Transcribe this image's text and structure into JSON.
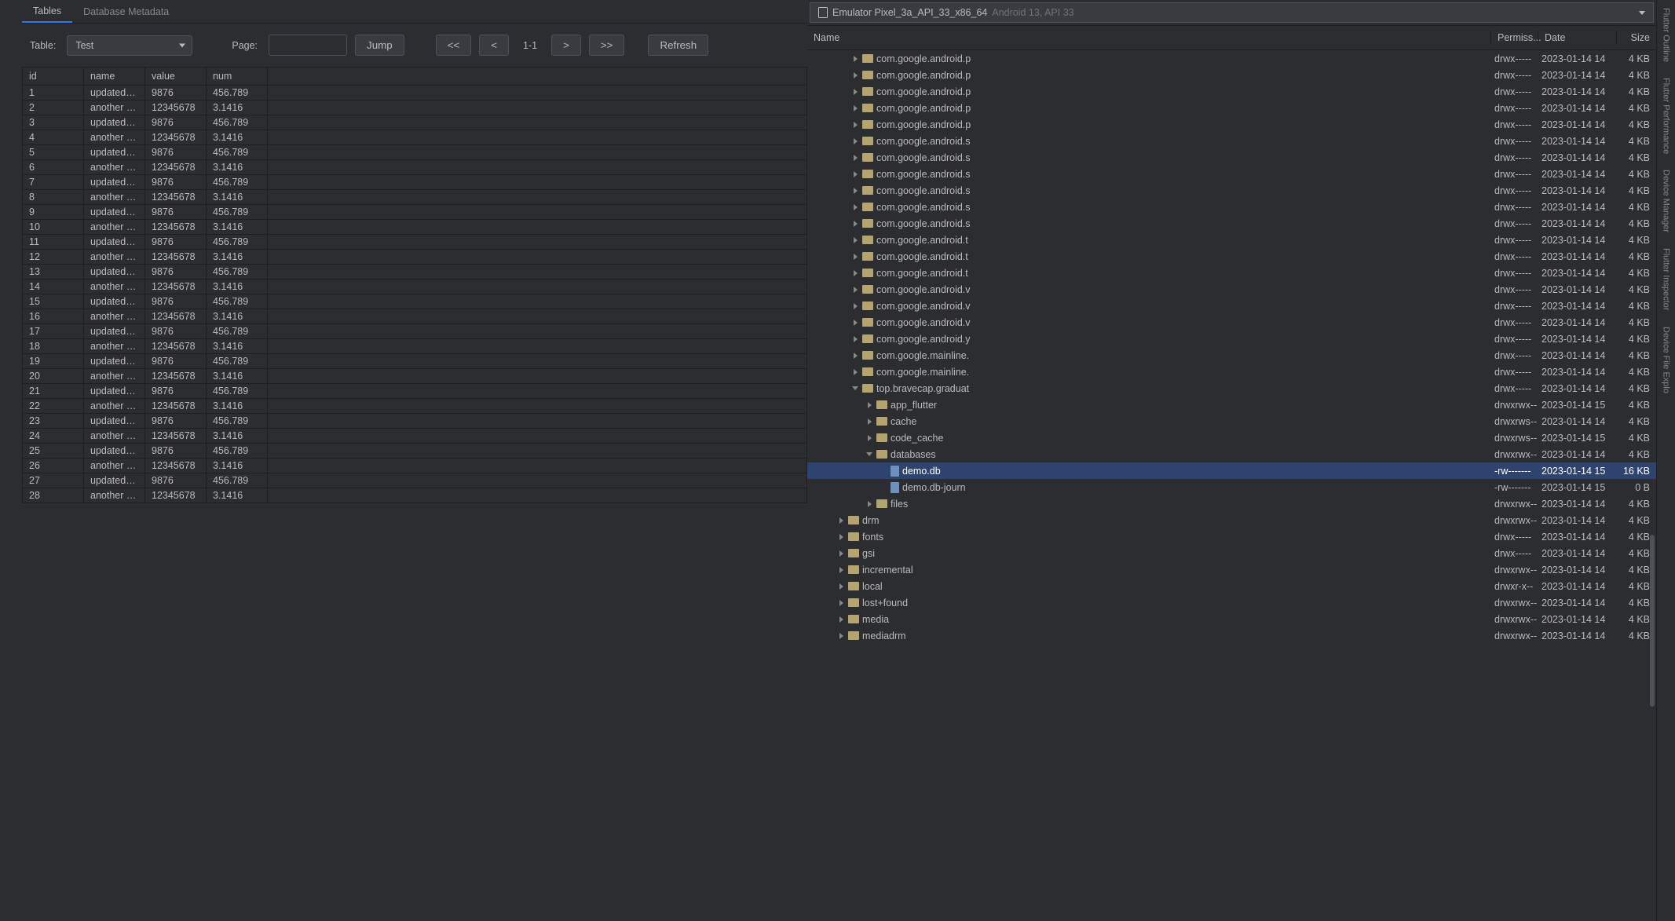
{
  "tabs": {
    "tables": "Tables",
    "metadata": "Database Metadata"
  },
  "toolbar": {
    "table_label": "Table:",
    "table_value": "Test",
    "page_label": "Page:",
    "page_value": "",
    "jump": "Jump",
    "first": "<<",
    "prev": "<",
    "counter": "1-1",
    "next": ">",
    "last": ">>",
    "refresh": "Refresh"
  },
  "table": {
    "headers": {
      "id": "id",
      "name": "name",
      "value": "value",
      "num": "num"
    },
    "rows": [
      {
        "id": "1",
        "name": "updated n...",
        "value": "9876",
        "num": "456.789"
      },
      {
        "id": "2",
        "name": "another n...",
        "value": "12345678",
        "num": "3.1416"
      },
      {
        "id": "3",
        "name": "updated n...",
        "value": "9876",
        "num": "456.789"
      },
      {
        "id": "4",
        "name": "another n...",
        "value": "12345678",
        "num": "3.1416"
      },
      {
        "id": "5",
        "name": "updated n...",
        "value": "9876",
        "num": "456.789"
      },
      {
        "id": "6",
        "name": "another n...",
        "value": "12345678",
        "num": "3.1416"
      },
      {
        "id": "7",
        "name": "updated n...",
        "value": "9876",
        "num": "456.789"
      },
      {
        "id": "8",
        "name": "another n...",
        "value": "12345678",
        "num": "3.1416"
      },
      {
        "id": "9",
        "name": "updated n...",
        "value": "9876",
        "num": "456.789"
      },
      {
        "id": "10",
        "name": "another n...",
        "value": "12345678",
        "num": "3.1416"
      },
      {
        "id": "11",
        "name": "updated n...",
        "value": "9876",
        "num": "456.789"
      },
      {
        "id": "12",
        "name": "another n...",
        "value": "12345678",
        "num": "3.1416"
      },
      {
        "id": "13",
        "name": "updated n...",
        "value": "9876",
        "num": "456.789"
      },
      {
        "id": "14",
        "name": "another n...",
        "value": "12345678",
        "num": "3.1416"
      },
      {
        "id": "15",
        "name": "updated n...",
        "value": "9876",
        "num": "456.789"
      },
      {
        "id": "16",
        "name": "another n...",
        "value": "12345678",
        "num": "3.1416"
      },
      {
        "id": "17",
        "name": "updated n...",
        "value": "9876",
        "num": "456.789"
      },
      {
        "id": "18",
        "name": "another n...",
        "value": "12345678",
        "num": "3.1416"
      },
      {
        "id": "19",
        "name": "updated n...",
        "value": "9876",
        "num": "456.789"
      },
      {
        "id": "20",
        "name": "another n...",
        "value": "12345678",
        "num": "3.1416"
      },
      {
        "id": "21",
        "name": "updated n...",
        "value": "9876",
        "num": "456.789"
      },
      {
        "id": "22",
        "name": "another n...",
        "value": "12345678",
        "num": "3.1416"
      },
      {
        "id": "23",
        "name": "updated n...",
        "value": "9876",
        "num": "456.789"
      },
      {
        "id": "24",
        "name": "another n...",
        "value": "12345678",
        "num": "3.1416"
      },
      {
        "id": "25",
        "name": "updated n...",
        "value": "9876",
        "num": "456.789"
      },
      {
        "id": "26",
        "name": "another n...",
        "value": "12345678",
        "num": "3.1416"
      },
      {
        "id": "27",
        "name": "updated n...",
        "value": "9876",
        "num": "456.789"
      },
      {
        "id": "28",
        "name": "another n...",
        "value": "12345678",
        "num": "3.1416"
      }
    ]
  },
  "device": {
    "name": "Emulator Pixel_3a_API_33_x86_64",
    "sub": "Android 13, API 33"
  },
  "tree_header": {
    "name": "Name",
    "perm": "Permiss...",
    "date": "Date",
    "size": "Size"
  },
  "tree": [
    {
      "depth": 2,
      "chev": "right",
      "icon": "folder",
      "name": "com.google.android.p",
      "perm": "drwx-----",
      "date": "2023-01-14 14",
      "size": "4 KB"
    },
    {
      "depth": 2,
      "chev": "right",
      "icon": "folder",
      "name": "com.google.android.p",
      "perm": "drwx-----",
      "date": "2023-01-14 14",
      "size": "4 KB"
    },
    {
      "depth": 2,
      "chev": "right",
      "icon": "folder",
      "name": "com.google.android.p",
      "perm": "drwx-----",
      "date": "2023-01-14 14",
      "size": "4 KB"
    },
    {
      "depth": 2,
      "chev": "right",
      "icon": "folder",
      "name": "com.google.android.p",
      "perm": "drwx-----",
      "date": "2023-01-14 14",
      "size": "4 KB"
    },
    {
      "depth": 2,
      "chev": "right",
      "icon": "folder",
      "name": "com.google.android.p",
      "perm": "drwx-----",
      "date": "2023-01-14 14",
      "size": "4 KB"
    },
    {
      "depth": 2,
      "chev": "right",
      "icon": "folder",
      "name": "com.google.android.s",
      "perm": "drwx-----",
      "date": "2023-01-14 14",
      "size": "4 KB"
    },
    {
      "depth": 2,
      "chev": "right",
      "icon": "folder",
      "name": "com.google.android.s",
      "perm": "drwx-----",
      "date": "2023-01-14 14",
      "size": "4 KB"
    },
    {
      "depth": 2,
      "chev": "right",
      "icon": "folder",
      "name": "com.google.android.s",
      "perm": "drwx-----",
      "date": "2023-01-14 14",
      "size": "4 KB"
    },
    {
      "depth": 2,
      "chev": "right",
      "icon": "folder",
      "name": "com.google.android.s",
      "perm": "drwx-----",
      "date": "2023-01-14 14",
      "size": "4 KB"
    },
    {
      "depth": 2,
      "chev": "right",
      "icon": "folder",
      "name": "com.google.android.s",
      "perm": "drwx-----",
      "date": "2023-01-14 14",
      "size": "4 KB"
    },
    {
      "depth": 2,
      "chev": "right",
      "icon": "folder",
      "name": "com.google.android.s",
      "perm": "drwx-----",
      "date": "2023-01-14 14",
      "size": "4 KB"
    },
    {
      "depth": 2,
      "chev": "right",
      "icon": "folder",
      "name": "com.google.android.t",
      "perm": "drwx-----",
      "date": "2023-01-14 14",
      "size": "4 KB"
    },
    {
      "depth": 2,
      "chev": "right",
      "icon": "folder",
      "name": "com.google.android.t",
      "perm": "drwx-----",
      "date": "2023-01-14 14",
      "size": "4 KB"
    },
    {
      "depth": 2,
      "chev": "right",
      "icon": "folder",
      "name": "com.google.android.t",
      "perm": "drwx-----",
      "date": "2023-01-14 14",
      "size": "4 KB"
    },
    {
      "depth": 2,
      "chev": "right",
      "icon": "folder",
      "name": "com.google.android.v",
      "perm": "drwx-----",
      "date": "2023-01-14 14",
      "size": "4 KB"
    },
    {
      "depth": 2,
      "chev": "right",
      "icon": "folder",
      "name": "com.google.android.v",
      "perm": "drwx-----",
      "date": "2023-01-14 14",
      "size": "4 KB"
    },
    {
      "depth": 2,
      "chev": "right",
      "icon": "folder",
      "name": "com.google.android.v",
      "perm": "drwx-----",
      "date": "2023-01-14 14",
      "size": "4 KB"
    },
    {
      "depth": 2,
      "chev": "right",
      "icon": "folder",
      "name": "com.google.android.y",
      "perm": "drwx-----",
      "date": "2023-01-14 14",
      "size": "4 KB"
    },
    {
      "depth": 2,
      "chev": "right",
      "icon": "folder",
      "name": "com.google.mainline.",
      "perm": "drwx-----",
      "date": "2023-01-14 14",
      "size": "4 KB"
    },
    {
      "depth": 2,
      "chev": "right",
      "icon": "folder",
      "name": "com.google.mainline.",
      "perm": "drwx-----",
      "date": "2023-01-14 14",
      "size": "4 KB"
    },
    {
      "depth": 2,
      "chev": "down",
      "icon": "folder",
      "name": "top.bravecap.graduat",
      "perm": "drwx-----",
      "date": "2023-01-14 14",
      "size": "4 KB"
    },
    {
      "depth": 3,
      "chev": "right",
      "icon": "folder",
      "name": "app_flutter",
      "perm": "drwxrwx--",
      "date": "2023-01-14 15",
      "size": "4 KB"
    },
    {
      "depth": 3,
      "chev": "right",
      "icon": "folder",
      "name": "cache",
      "perm": "drwxrws--",
      "date": "2023-01-14 14",
      "size": "4 KB"
    },
    {
      "depth": 3,
      "chev": "right",
      "icon": "folder",
      "name": "code_cache",
      "perm": "drwxrws--",
      "date": "2023-01-14 15",
      "size": "4 KB"
    },
    {
      "depth": 3,
      "chev": "down",
      "icon": "folder",
      "name": "databases",
      "perm": "drwxrwx--",
      "date": "2023-01-14 14",
      "size": "4 KB"
    },
    {
      "depth": 4,
      "chev": "none",
      "icon": "file",
      "name": "demo.db",
      "perm": "-rw-------",
      "date": "2023-01-14 15",
      "size": "16 KB",
      "selected": true
    },
    {
      "depth": 4,
      "chev": "none",
      "icon": "file",
      "name": "demo.db-journ",
      "perm": "-rw-------",
      "date": "2023-01-14 15",
      "size": "0 B"
    },
    {
      "depth": 3,
      "chev": "right",
      "icon": "folder",
      "name": "files",
      "perm": "drwxrwx--",
      "date": "2023-01-14 14",
      "size": "4 KB"
    },
    {
      "depth": 1,
      "chev": "right",
      "icon": "folder",
      "name": "drm",
      "perm": "drwxrwx--",
      "date": "2023-01-14 14",
      "size": "4 KB"
    },
    {
      "depth": 1,
      "chev": "right",
      "icon": "folder",
      "name": "fonts",
      "perm": "drwx-----",
      "date": "2023-01-14 14",
      "size": "4 KB"
    },
    {
      "depth": 1,
      "chev": "right",
      "icon": "folder",
      "name": "gsi",
      "perm": "drwx-----",
      "date": "2023-01-14 14",
      "size": "4 KB"
    },
    {
      "depth": 1,
      "chev": "right",
      "icon": "folder",
      "name": "incremental",
      "perm": "drwxrwx--",
      "date": "2023-01-14 14",
      "size": "4 KB"
    },
    {
      "depth": 1,
      "chev": "right",
      "icon": "folder",
      "name": "local",
      "perm": "drwxr-x--",
      "date": "2023-01-14 14",
      "size": "4 KB"
    },
    {
      "depth": 1,
      "chev": "right",
      "icon": "folder",
      "name": "lost+found",
      "perm": "drwxrwx--",
      "date": "2023-01-14 14",
      "size": "4 KB"
    },
    {
      "depth": 1,
      "chev": "right",
      "icon": "folder",
      "name": "media",
      "perm": "drwxrwx--",
      "date": "2023-01-14 14",
      "size": "4 KB"
    },
    {
      "depth": 1,
      "chev": "right",
      "icon": "folder",
      "name": "mediadrm",
      "perm": "drwxrwx--",
      "date": "2023-01-14 14",
      "size": "4 KB"
    }
  ],
  "right_strip": [
    "Flutter Outline",
    "Flutter Performance",
    "Device Manager",
    "Flutter Inspector",
    "Device File Explo"
  ]
}
